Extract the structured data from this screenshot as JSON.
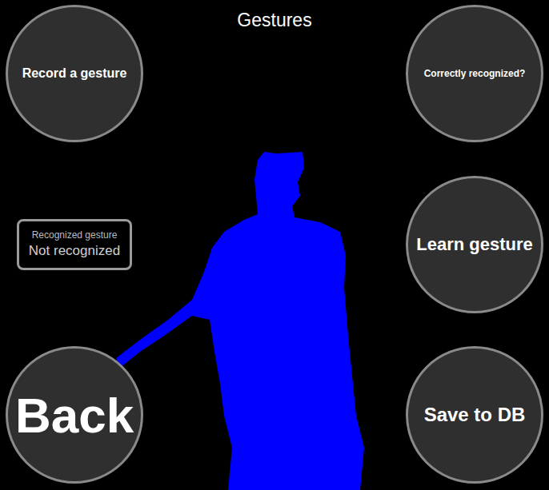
{
  "window": {
    "title": "Gestures"
  },
  "left_buttons": [
    "Record a gesture",
    "Back"
  ],
  "status": {
    "label": "Recognized gesture",
    "value": "Not recognized"
  },
  "right_buttons": [
    "Correctly recognized?",
    "Learn gesture",
    "Save to DB"
  ]
}
